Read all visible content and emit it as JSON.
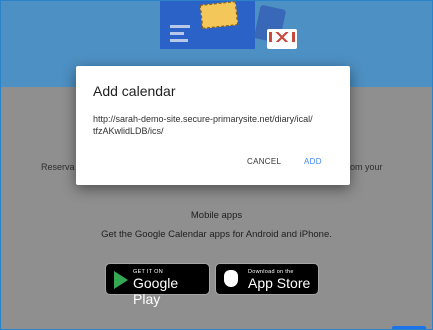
{
  "background_page": {
    "left_fragment": "Reserva",
    "right_fragment": "om your",
    "mobile_apps": {
      "title": "Mobile apps",
      "description": "Get the Google Calendar apps for Android and iPhone."
    },
    "badges": {
      "google_play": {
        "small": "GET IT ON",
        "big": "Google Play"
      },
      "app_store": {
        "small": "Download on the",
        "big": "App Store"
      }
    }
  },
  "dialog": {
    "title": "Add calendar",
    "url": "http://sarah-demo-site.secure-primarysite.net/diary/ical/tfzAKwlidLDB/ics/",
    "cancel_label": "CANCEL",
    "add_label": "ADD"
  },
  "colors": {
    "accent": "#4285f4",
    "hero_bg": "#4d90c3",
    "overlay_bg": "#8f8f8f"
  }
}
